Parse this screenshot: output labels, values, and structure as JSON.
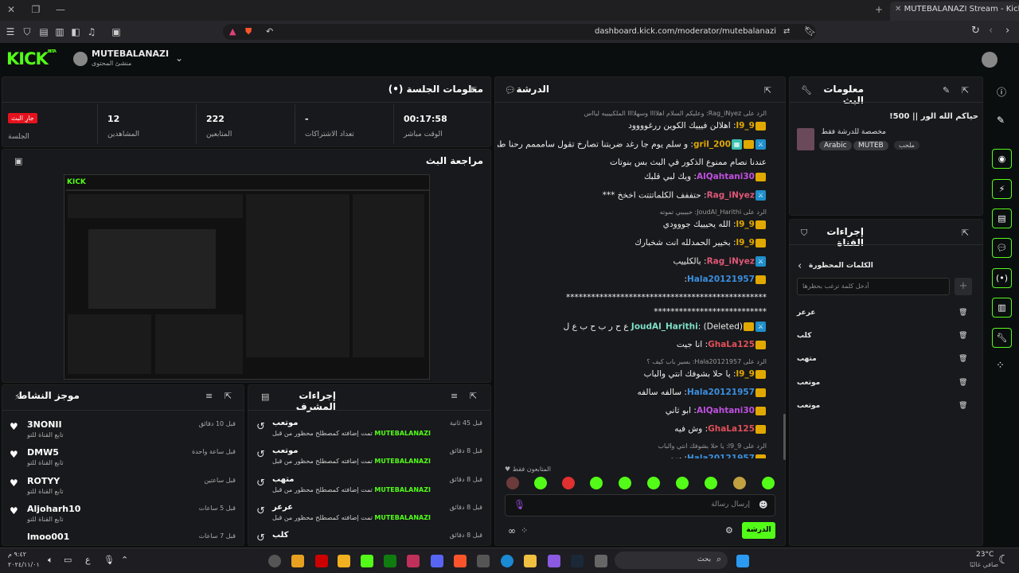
{
  "browser": {
    "tab_title": "MUTEBALANAZI Stream - Kick",
    "url": "dashboard.kick.com/moderator/mutebalanazi"
  },
  "header": {
    "logo": "KICK",
    "logo_sup": "BETA",
    "username": "MUTEBALANAZI",
    "role": "منشئ المحتوى"
  },
  "session": {
    "title": "معلومات الجلسة",
    "live_badge": "جارِ البث",
    "live_label": "الجلسة",
    "stats": [
      {
        "value": "12",
        "label": "المشاهدين"
      },
      {
        "value": "222",
        "label": "المتابعين"
      },
      {
        "value": "-",
        "label": "تعداد الاشتراكات"
      },
      {
        "value": "00:17:58",
        "label": "الوقت مباشر"
      }
    ]
  },
  "preview": {
    "title": "مراجعة البث"
  },
  "activity": {
    "title": "موجز النشاط",
    "items": [
      {
        "name": "3NONII",
        "sub": "تابع القناة للتو",
        "time": "قبل 10 دقائق"
      },
      {
        "name": "DMW5",
        "sub": "تابع القناة للتو",
        "time": "قبل ساعة واحدة"
      },
      {
        "name": "ROTYY",
        "sub": "تابع القناة للتو",
        "time": "قبل ساعتين"
      },
      {
        "name": "Aljoharh10",
        "sub": "تابع القناة للتو",
        "time": "قبل 5 ساعات"
      },
      {
        "name": "lmoo001",
        "sub": "",
        "time": "قبل 7 ساعات"
      }
    ]
  },
  "modactions": {
    "title": "إجراءات المشرف",
    "items": [
      {
        "word": "موتعب",
        "desc": "تمت إضافته كمصطلح محظور من قبل",
        "by": "MUTEBALANAZI",
        "time": "قبل 45 ثانية"
      },
      {
        "word": "موتعب",
        "desc": "تمت إضافته كمصطلح محظور من قبل",
        "by": "MUTEBALANAZI",
        "time": "قبل 8 دقائق"
      },
      {
        "word": "متهب",
        "desc": "تمت إضافته كمصطلح محظور من قبل",
        "by": "MUTEBALANAZI",
        "time": "قبل 8 دقائق"
      },
      {
        "word": "عرعر",
        "desc": "تمت إضافته كمصطلح محظور من قبل",
        "by": "MUTEBALANAZI",
        "time": "قبل 8 دقائق"
      },
      {
        "word": "كلب",
        "desc": "تمت إضافته كمصطلح محظور من قبل",
        "by": "",
        "time": "قبل 8 دقائق"
      }
    ]
  },
  "chat": {
    "title": "الدرشة",
    "placeholder": "إرسال رسالة",
    "send": "الدرشة",
    "followers_only": "المتابعون فقط",
    "messages": [
      {
        "reply": "الرد على Rag_iNyez: وعليكم السلام اهلاااا وسهلاااا الملكييييه ليااس"
      },
      {
        "user": "l9_9",
        "color": "#e0a800",
        "text": "اهلالن فيييك الكوين ررغوووود",
        "badges": "c"
      },
      {
        "user": "gril_200",
        "color": "#e0a800",
        "text": "و سلم يوم جا رغد ضربتنا تصارخ تقول سامممم رحنا طردناه",
        "badges": "mcg"
      },
      {
        "cont": "عندنا نصام ممنوع الذكور في البث بس بنوتات"
      },
      {
        "user": "AlQahtani30",
        "color": "#c050e0",
        "text": "ويك لبي قلبك",
        "badges": "c"
      },
      {
        "user": "Rag_iNyez",
        "color": "#e05878",
        "text": "حتففف الكلماتتتت اخخخ ***",
        "badges": "m"
      },
      {
        "reply": "الرد على JoudAl_Harithi: حبيبيي تموته"
      },
      {
        "user": "l9_9",
        "color": "#e0a800",
        "text": "الله يحيييك جووودي",
        "badges": "c"
      },
      {
        "user": "l9_9",
        "color": "#e0a800",
        "text": "بخيير الحمدلله انت شخبارك",
        "badges": "c"
      },
      {
        "user": "Rag_iNyez",
        "color": "#e05878",
        "text": "بالكلييب",
        "badges": "m"
      },
      {
        "user": "Hala20121957",
        "color": "#3b8fe0",
        "text": "",
        "badges": "c"
      },
      {
        "cont": "************************************************"
      },
      {
        "cont": "***************************"
      },
      {
        "user": "JoudAl_Harithi",
        "color": "#7fe0c8",
        "text": "(Deleted) ع ح ر ب ح ب ع ل",
        "badges": "mc"
      },
      {
        "user": "GhaLa125",
        "color": "#e0505a",
        "text": "انا جيت",
        "badges": "c"
      },
      {
        "reply": "الرد على Hala20121957: بسير باب كيف ؟"
      },
      {
        "user": "l9_9",
        "color": "#e0a800",
        "text": "يا حلا بشوفك انتي والباب",
        "badges": "c"
      },
      {
        "user": "Hala20121957",
        "color": "#3b8fe0",
        "text": "سالفه سالفه",
        "badges": "c"
      },
      {
        "user": "AlQahtani30",
        "color": "#c050e0",
        "text": "ابو ثاني",
        "badges": "c"
      },
      {
        "user": "GhaLa125",
        "color": "#e0505a",
        "text": "وش فيه",
        "badges": "c"
      },
      {
        "reply": "الرد على l9_9: يا حلا بشوفك انتي والباب"
      },
      {
        "user": "Hala20121957",
        "color": "#3b8fe0",
        "text": "سمي",
        "badges": "c"
      }
    ]
  },
  "streaminfo": {
    "title": "معلومات البث",
    "stream_title": "حياكم الله الور || 500!",
    "desc": "مخصصة للدرشة فقط",
    "tags": [
      "Arabic",
      "MUTEB"
    ],
    "tag_extra": "ملحب"
  },
  "channel": {
    "title": "إجراءات القناة",
    "banned_title": "الكلمات المحظورة",
    "input_placeholder": "أدخل كلمة ترغب بحظرها",
    "words": [
      "عرعر",
      "كلب",
      "متهب",
      "موتعب",
      "موتعب"
    ]
  },
  "taskbar": {
    "weather": "23°C",
    "weather_sub": "صافي غالبًا",
    "search": "بحث",
    "time": "٩:٤٢ م",
    "date": "٢٠٢٤/١١/٠١"
  }
}
